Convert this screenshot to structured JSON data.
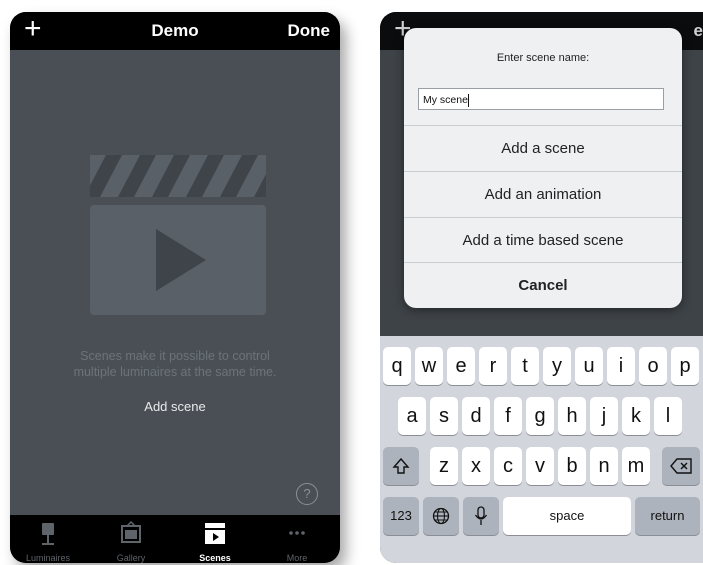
{
  "left": {
    "nav": {
      "add_symbol": "+",
      "title": "Demo",
      "done": "Done"
    },
    "empty_state": {
      "icon": "clapperboard-play-icon",
      "description_line1": "Scenes make it possible to control",
      "description_line2": "multiple luminaires at the same time.",
      "add_scene": "Add scene"
    },
    "help_symbol": "?",
    "tabs": [
      {
        "label": "Luminaires",
        "icon": "lamp-icon",
        "active": false
      },
      {
        "label": "Gallery",
        "icon": "gallery-icon",
        "active": false
      },
      {
        "label": "Scenes",
        "icon": "clapperboard-icon",
        "active": true
      },
      {
        "label": "More",
        "icon": "more-dots-icon",
        "active": false
      }
    ]
  },
  "right": {
    "nav": {
      "add_symbol": "+",
      "done_fragment": "e"
    },
    "alert": {
      "title": "Enter scene name:",
      "input_value": "My scene",
      "buttons": [
        "Add a scene",
        "Add an animation",
        "Add a time based scene"
      ],
      "cancel": "Cancel"
    },
    "keyboard": {
      "row1": [
        "q",
        "w",
        "e",
        "r",
        "t",
        "y",
        "u",
        "i",
        "o",
        "p"
      ],
      "row2": [
        "a",
        "s",
        "d",
        "f",
        "g",
        "h",
        "j",
        "k",
        "l"
      ],
      "row3": [
        "z",
        "x",
        "c",
        "v",
        "b",
        "n",
        "m"
      ],
      "numbers": "123",
      "space": "space",
      "return": "return"
    }
  },
  "colors": {
    "screen_bg": "#4a4f55",
    "bar_bg": "#000000",
    "alert_bg": "#eff0f1",
    "keyboard_bg": "#d2d5db"
  }
}
